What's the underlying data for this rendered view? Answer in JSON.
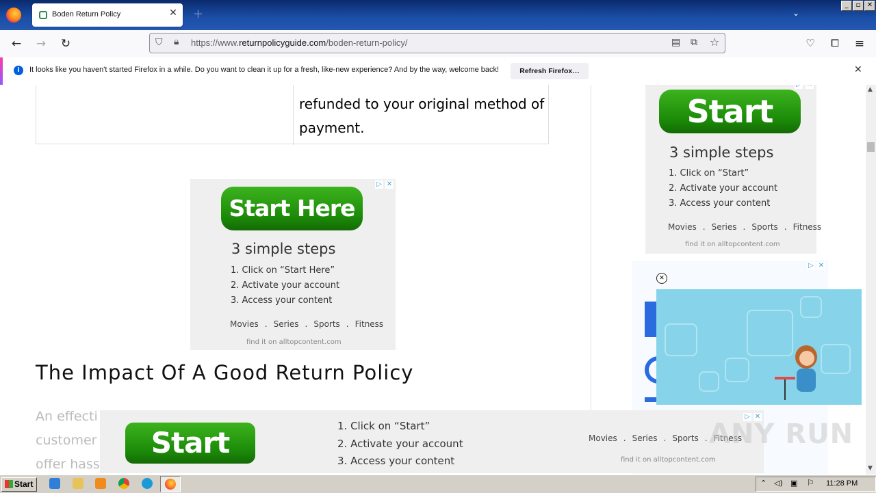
{
  "browser": {
    "tab_title": "Boden Return Policy",
    "url_prefix": "https://www.",
    "url_domain": "returnpolicyguide.com",
    "url_path": "/boden-return-policy/"
  },
  "notification": {
    "message": "It looks like you haven't started Firefox in a while. Do you want to clean it up for a fresh, like-new experience? And by the way, welcome back!",
    "button": "Refresh Firefox…"
  },
  "content": {
    "cell_line1": "refunded to your original method of",
    "cell_line2": "payment.",
    "heading": "The Impact Of A Good Return Policy",
    "faded_lines": [
      "An effecti",
      "customer",
      "offer hass"
    ]
  },
  "ads": {
    "center": {
      "button": "Start Here",
      "headline": "3 simple steps",
      "steps": [
        "1. Click on “Start Here”",
        "2. Activate your account",
        "3. Access your content"
      ],
      "categories": [
        "Movies",
        ".",
        "Series",
        ".",
        "Sports",
        ".",
        "Fitness"
      ],
      "footer": "find it on alltopcontent.com"
    },
    "sidebar": {
      "button": "Start",
      "headline": "3 simple steps",
      "steps": [
        "1. Click on “Start”",
        "2. Activate your account",
        "3. Access your content"
      ],
      "categories": [
        "Movies",
        ".",
        "Series",
        ".",
        "Sports",
        ".",
        "Fitness"
      ],
      "footer": "find it on alltopcontent.com"
    },
    "bottom": {
      "button": "Start",
      "steps": [
        "1. Click on “Start”",
        "2. Activate your account",
        "3. Access your content"
      ],
      "categories": [
        "Movies",
        ".",
        "Series",
        ".",
        "Sports",
        ".",
        "Fitness"
      ],
      "footer": "find it on alltopcontent.com"
    }
  },
  "taskbar": {
    "start": "Start",
    "clock": "11:28 PM"
  },
  "watermark": "ANY RUN"
}
